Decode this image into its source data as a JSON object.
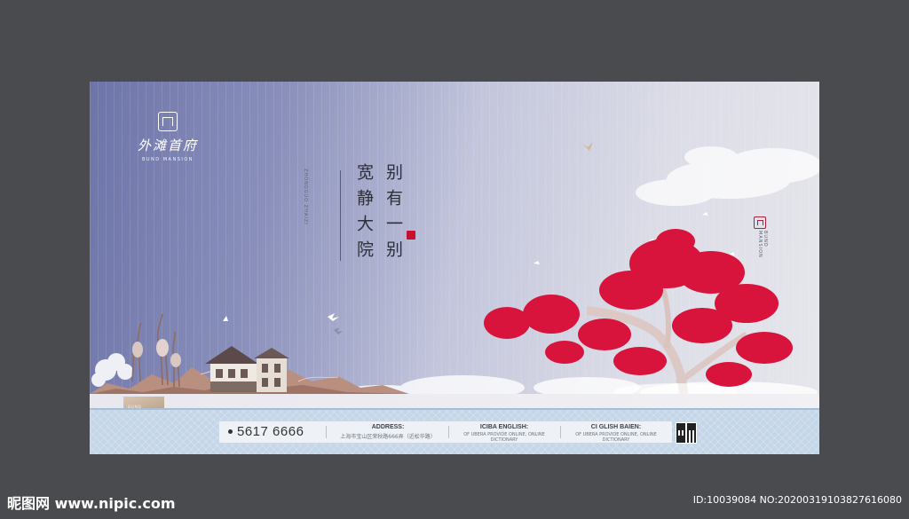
{
  "brand": {
    "name_cn": "外滩首府",
    "name_en": "BUND MANSION"
  },
  "slogan": {
    "col1": "别有一别",
    "col2": "宽静大院",
    "pinyin": "ZHONGGUO  ZHAIZI"
  },
  "side_seal": {
    "vertical_text": "BUND MANSION"
  },
  "card": {
    "line1": "BUND",
    "line2": "MANSION"
  },
  "infobar": {
    "phone": "5617 6666",
    "address_title": "ADDRESS:",
    "address_text": "上海市宝山区荣秋路666弄（近松华路）",
    "iciba_title": "ICIBA ENGLISH:",
    "iciba_text": "OF UBERA PROVIDE ONLINE, ONLINE DICTIONARY",
    "cglish_title": "CI GLISH BAIEN:",
    "cglish_text": "OF UBERA PROVIDE ONLINE, ONLINE DICTIONARY"
  },
  "watermark": {
    "site": "昵图网 www.nipic.com",
    "id": "ID:10039084 NO:20200319103827616080"
  },
  "colors": {
    "tree_red": "#d8133c",
    "sky_left": "#6d74a8",
    "band_blue": "#c4d6e8"
  }
}
